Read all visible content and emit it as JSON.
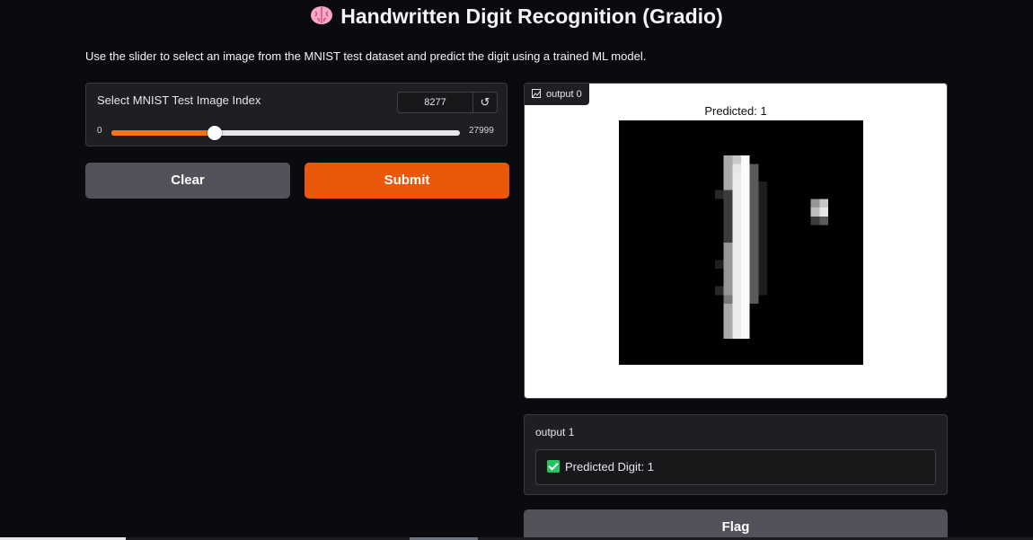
{
  "header": {
    "title": "Handwritten Digit Recognition (Gradio)",
    "icon": "brain-icon"
  },
  "description": "Use the slider to select an image from the MNIST test dataset and predict the digit using a trained ML model.",
  "slider": {
    "label": "Select MNIST Test Image Index",
    "value": "8277",
    "min": "0",
    "max": "27999",
    "fraction": 0.2956,
    "reset_icon": "reset-icon",
    "reset_symbol": "↺",
    "accent": "#f97316"
  },
  "buttons": {
    "clear": "Clear",
    "submit": "Submit",
    "flag": "Flag"
  },
  "output0": {
    "label": "output 0",
    "icon": "image-icon",
    "caption": "Predicted: 1"
  },
  "output1": {
    "label": "output 1",
    "status_icon": "check-icon",
    "text": "Predicted Digit: 1"
  },
  "colors": {
    "submit": "#ea580c",
    "secondary": "#52525b",
    "background": "#0b0b0f",
    "success": "#22c55e"
  }
}
